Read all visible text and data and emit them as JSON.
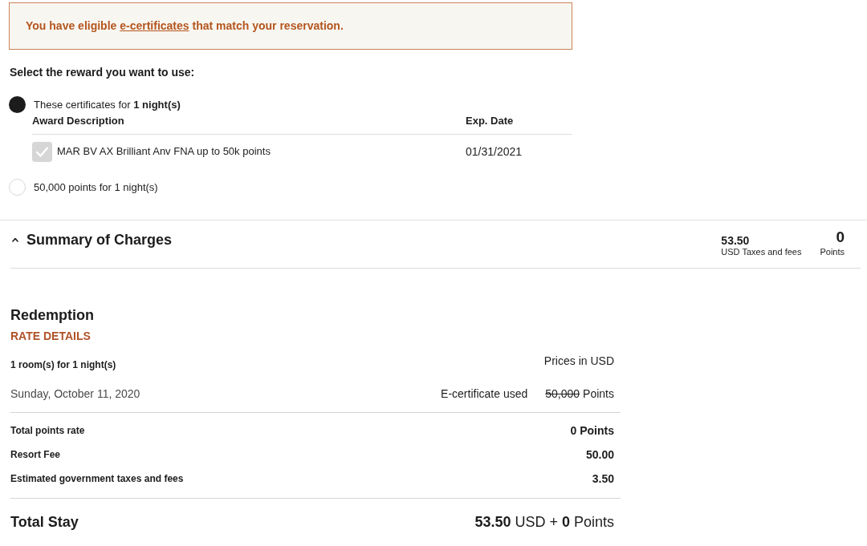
{
  "alert": {
    "text_before": "You have eligible ",
    "link": "e-certificates",
    "text_after": " that match your reservation."
  },
  "reward_selection": {
    "heading": "Select the reward you want to use:",
    "options": [
      {
        "kind": "certificates",
        "label": "These certificates for **1 night(s)**",
        "selected": true,
        "table": {
          "columns": [
            "Award Description",
            "Exp. Date"
          ],
          "rows": [
            {
              "checked": true,
              "disabled": true,
              "description": "MAR BV AX Brilliant Anv FNA up to 50k points",
              "exp_date": "01/31/2021"
            }
          ]
        }
      },
      {
        "kind": "points",
        "label": "50,000 points for 1 night(s)",
        "selected": false
      }
    ]
  },
  "summary": {
    "title": "Summary of Charges",
    "expanded": true,
    "taxes_amount": "53.50",
    "taxes_label": "USD Taxes and fees",
    "points_amount": "0",
    "points_label": "Points"
  },
  "rate_details": {
    "title": "Redemption",
    "subtitle": "RATE DETAILS",
    "room_info": "1 room(s) for 1 night(s)",
    "currency_note": "Prices in USD",
    "nights": [
      {
        "date": "Sunday, October 11, 2020",
        "note": "E-certificate used",
        "price": "50,000",
        "price_struck": true,
        "unit": "Points"
      }
    ],
    "lines": [
      {
        "label": "Total points rate",
        "value": "0 Points"
      },
      {
        "label": "Resort Fee",
        "value": "50.00"
      },
      {
        "label": "Estimated government taxes and fees",
        "value": "3.50"
      }
    ],
    "total": {
      "label": "Total Stay",
      "value": "**53.50** USD + **0** Points"
    }
  }
}
